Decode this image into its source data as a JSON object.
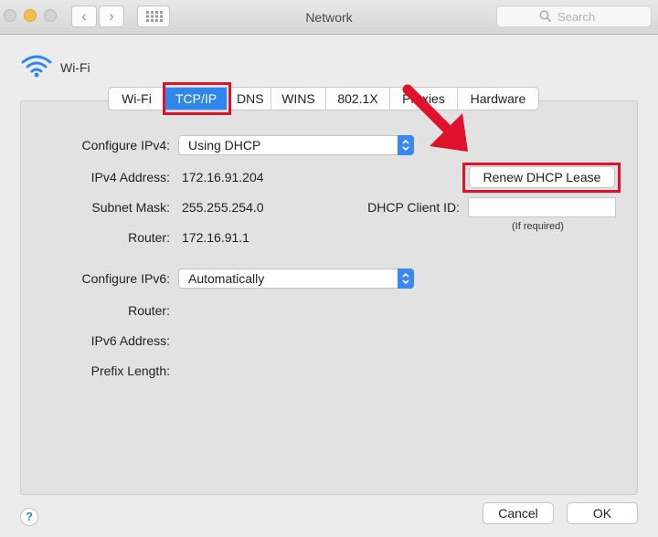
{
  "window": {
    "title": "Network"
  },
  "toolbar": {
    "search_placeholder": "Search"
  },
  "interface": {
    "name": "Wi-Fi"
  },
  "tabs": [
    {
      "label": "Wi-Fi"
    },
    {
      "label": "TCP/IP",
      "selected": true
    },
    {
      "label": "DNS"
    },
    {
      "label": "WINS"
    },
    {
      "label": "802.1X"
    },
    {
      "label": "Proxies"
    },
    {
      "label": "Hardware"
    }
  ],
  "ipv4": {
    "configure_label": "Configure IPv4:",
    "configure_value": "Using DHCP",
    "address_label": "IPv4 Address:",
    "address_value": "172.16.91.204",
    "subnet_label": "Subnet Mask:",
    "subnet_value": "255.255.254.0",
    "router_label": "Router:",
    "router_value": "172.16.91.1",
    "renew_button": "Renew DHCP Lease",
    "client_id_label": "DHCP Client ID:",
    "client_id_value": "",
    "client_id_hint": "(If required)"
  },
  "ipv6": {
    "configure_label": "Configure IPv6:",
    "configure_value": "Automatically",
    "router_label": "Router:",
    "address_label": "IPv6 Address:",
    "prefix_label": "Prefix Length:"
  },
  "footer": {
    "help": "?",
    "cancel": "Cancel",
    "ok": "OK"
  },
  "colors": {
    "accent": "#2f86ec",
    "highlight": "#e0112b"
  }
}
